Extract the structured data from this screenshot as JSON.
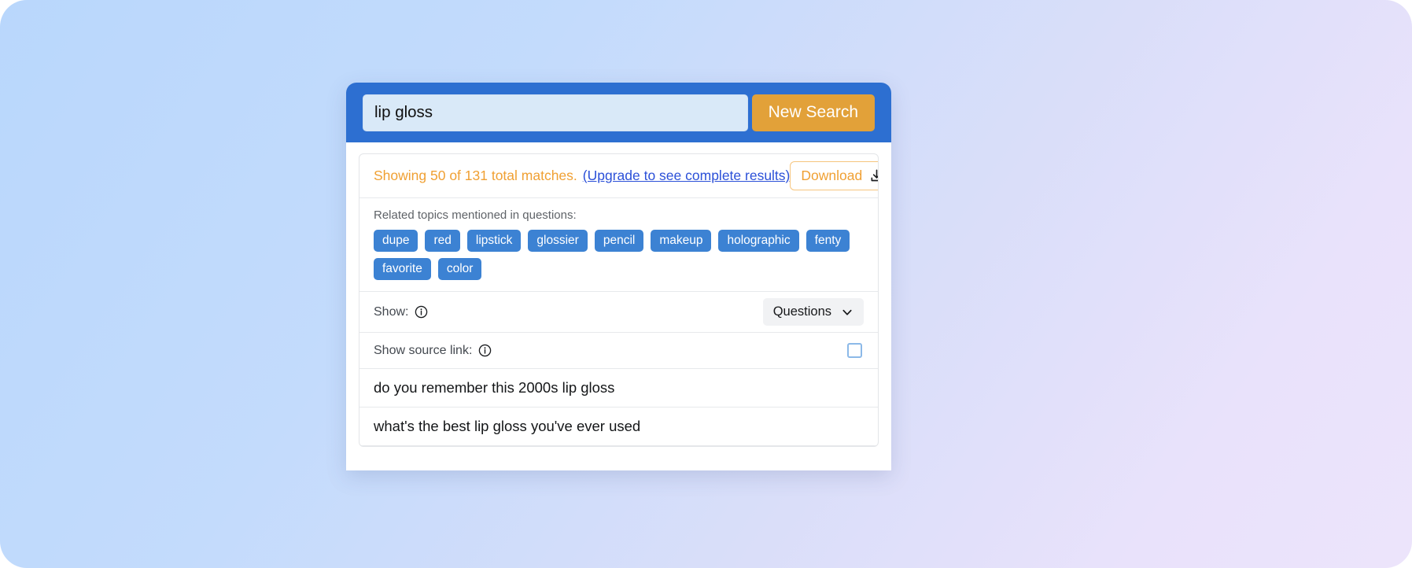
{
  "theme": {
    "header_blue": "#2d6fd1",
    "accent_orange": "#e2a139",
    "text_orange": "#f0a033",
    "link_blue": "#2b50d8",
    "chip_blue": "#3c82d3",
    "bg_gradient_start": "#b9d7fc",
    "bg_gradient_end": "#ece4fb"
  },
  "search": {
    "query": "lip gloss",
    "placeholder": "lip gloss",
    "new_search_label": "New Search"
  },
  "results_summary": {
    "matches_text": "Showing 50 of 131 total matches.",
    "shown_count": 50,
    "total_count": 131,
    "upgrade_link": "(Upgrade to see complete results)",
    "download_label": "Download",
    "download_icon": "download-icon"
  },
  "topics": {
    "label": "Related topics mentioned in questions:",
    "items": [
      {
        "label": "dupe"
      },
      {
        "label": "red"
      },
      {
        "label": "lipstick"
      },
      {
        "label": "glossier"
      },
      {
        "label": "pencil"
      },
      {
        "label": "makeup"
      },
      {
        "label": "holographic"
      },
      {
        "label": "fenty"
      },
      {
        "label": "favorite"
      },
      {
        "label": "color"
      }
    ]
  },
  "controls": {
    "show": {
      "label": "Show:",
      "info_icon": "info-icon",
      "selected": "Questions",
      "options": [
        "Questions"
      ],
      "chevron_icon": "chevron-down-icon"
    },
    "source_link": {
      "label": "Show source link:",
      "info_icon": "info-icon",
      "checked": false
    }
  },
  "results": [
    {
      "text": "do you remember this 2000s lip gloss"
    },
    {
      "text": "what's the best lip gloss you've ever used"
    }
  ]
}
